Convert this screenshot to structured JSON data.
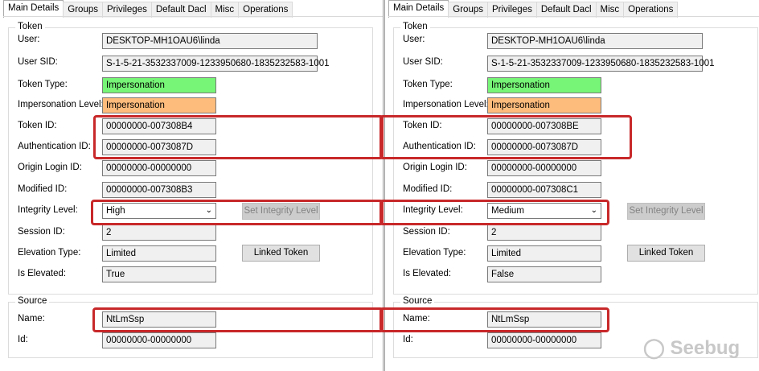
{
  "tabs": [
    "Main Details",
    "Groups",
    "Privileges",
    "Default Dacl",
    "Misc",
    "Operations"
  ],
  "token_group": "Token",
  "source_group": "Source",
  "labels": {
    "user": "User:",
    "user_sid": "User SID:",
    "token_type": "Token Type:",
    "imp_level": "Impersonation Level:",
    "token_id": "Token ID:",
    "auth_id": "Authentication ID:",
    "origin": "Origin Login ID:",
    "modified": "Modified ID:",
    "integrity": "Integrity Level:",
    "session": "Session ID:",
    "elevation": "Elevation Type:",
    "elevated": "Is Elevated:",
    "name": "Name:",
    "id": "Id:"
  },
  "buttons": {
    "set_integrity": "Set Integrity Level",
    "linked": "Linked Token"
  },
  "left": {
    "user": "DESKTOP-MH1OAU6\\linda",
    "user_sid": "S-1-5-21-3532337009-1233950680-1835232583-1001",
    "token_type": "Impersonation",
    "imp_level": "Impersonation",
    "token_id": "00000000-007308B4",
    "auth_id": "00000000-0073087D",
    "origin": "00000000-00000000",
    "modified": "00000000-007308B3",
    "integrity": "High",
    "session": "2",
    "elevation": "Limited",
    "elevated": "True",
    "name": "NtLmSsp",
    "id": "00000000-00000000"
  },
  "right": {
    "user": "DESKTOP-MH1OAU6\\linda",
    "user_sid": "S-1-5-21-3532337009-1233950680-1835232583-1001",
    "token_type": "Impersonation",
    "imp_level": "Impersonation",
    "token_id": "00000000-007308BE",
    "auth_id": "00000000-0073087D",
    "origin": "00000000-00000000",
    "modified": "00000000-007308C1",
    "integrity": "Medium",
    "session": "2",
    "elevation": "Limited",
    "elevated": "False",
    "name": "NtLmSsp",
    "id": "00000000-00000000"
  },
  "colors": {
    "token_type_bg": "#76f576",
    "imp_level_bg": "#fdbb7c",
    "highlight": "#c8282a"
  },
  "watermark": "Seebug"
}
